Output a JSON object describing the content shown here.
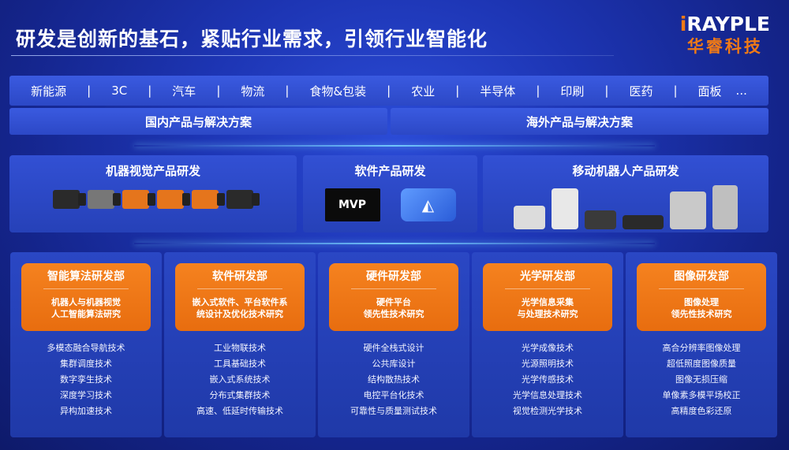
{
  "header": {
    "title": "研发是创新的基石，紧贴行业需求，引领行业智能化",
    "logo_en_prefix": "i",
    "logo_en_rest": "RAYPLE",
    "logo_cn": "华睿科技"
  },
  "industries": [
    "新能源",
    "3C",
    "汽车",
    "物流",
    "食物&包装",
    "农业",
    "半导体",
    "印刷",
    "医药",
    "面板",
    "..."
  ],
  "industry_separator": "|",
  "markets": [
    {
      "label": "国内产品与解决方案"
    },
    {
      "label": "海外产品与解决方案"
    }
  ],
  "products": [
    {
      "title": "机器视觉产品研发"
    },
    {
      "title": "软件产品研发",
      "logo1": "MVP",
      "logo2": "◭"
    },
    {
      "title": "移动机器人产品研发"
    }
  ],
  "departments": [
    {
      "name": "智能算法研发部",
      "desc_line1": "机器人与机器视觉",
      "desc_line2": "人工智能算法研究",
      "techs": [
        "多模态融合导航技术",
        "集群调度技术",
        "数字孪生技术",
        "深度学习技术",
        "异构加速技术"
      ]
    },
    {
      "name": "软件研发部",
      "desc_line1": "嵌入式软件、平台软件系",
      "desc_line2": "统设计及优化技术研究",
      "techs": [
        "工业物联技术",
        "工具基础技术",
        "嵌入式系统技术",
        "分布式集群技术",
        "高速、低延时传输技术"
      ]
    },
    {
      "name": "硬件研发部",
      "desc_line1": "硬件平台",
      "desc_line2": "领先性技术研究",
      "techs": [
        "硬件全栈式设计",
        "公共库设计",
        "结构散热技术",
        "电控平台化技术",
        "可靠性与质量测试技术"
      ]
    },
    {
      "name": "光学研发部",
      "desc_line1": "光学信息采集",
      "desc_line2": "与处理技术研究",
      "techs": [
        "光学成像技术",
        "光源照明技术",
        "光学传感技术",
        "光学信息处理技术",
        "视觉检测光学技术"
      ]
    },
    {
      "name": "图像研发部",
      "desc_line1": "图像处理",
      "desc_line2": "领先性技术研究",
      "techs": [
        "高合分辨率图像处理",
        "超低照度图像质量",
        "图像无损压缩",
        "单像素多模平场校正",
        "高精度色彩还原"
      ]
    }
  ],
  "colors": {
    "accent_orange": "#f07a16",
    "panel_blue": "#2c48c6",
    "background": "#1d35b4"
  }
}
